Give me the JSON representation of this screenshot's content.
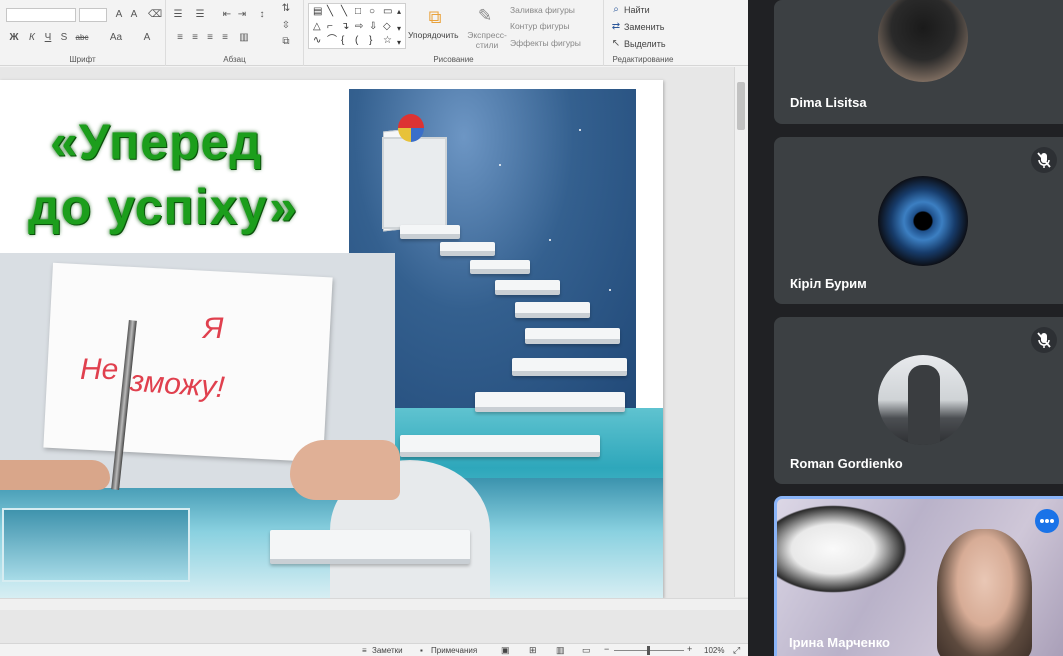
{
  "ribbon": {
    "groups": {
      "font": "Шрифт",
      "paragraph": "Абзац",
      "drawing": "Рисование",
      "editing": "Редактирование"
    },
    "font_buttons": [
      "Ж",
      "К",
      "Ч",
      "S",
      "abc",
      "Aa",
      "A"
    ],
    "arrange_label": "Упорядочить",
    "quick_styles_label": "Экспресс-стили",
    "shape_fill": "Заливка фигуры",
    "shape_outline": "Контур фигуры",
    "shape_effects": "Эффекты фигуры",
    "find": "Найти",
    "replace": "Заменить",
    "select": "Выделить"
  },
  "slide": {
    "title_line1": "«Уперед",
    "title_line2": "до успіху»",
    "note_word1": "Я",
    "note_word2": "Не",
    "note_word3": "зможу!"
  },
  "status_bar": {
    "notes": "Заметки",
    "comments": "Примечания",
    "zoom": "102%"
  },
  "participants": [
    {
      "name": "Dima Lisitsa",
      "muted": false
    },
    {
      "name": "Кіріл Бурим",
      "muted": true
    },
    {
      "name": "Roman Gordienko",
      "muted": true
    },
    {
      "name": "Ірина Марченко",
      "muted": false
    }
  ],
  "colors": {
    "title_green": "#1c9e1c",
    "note_red": "#e0404e",
    "meet_bg": "#202124",
    "tile_bg": "#3c4043",
    "active_speaker": "#8ab4f8"
  }
}
